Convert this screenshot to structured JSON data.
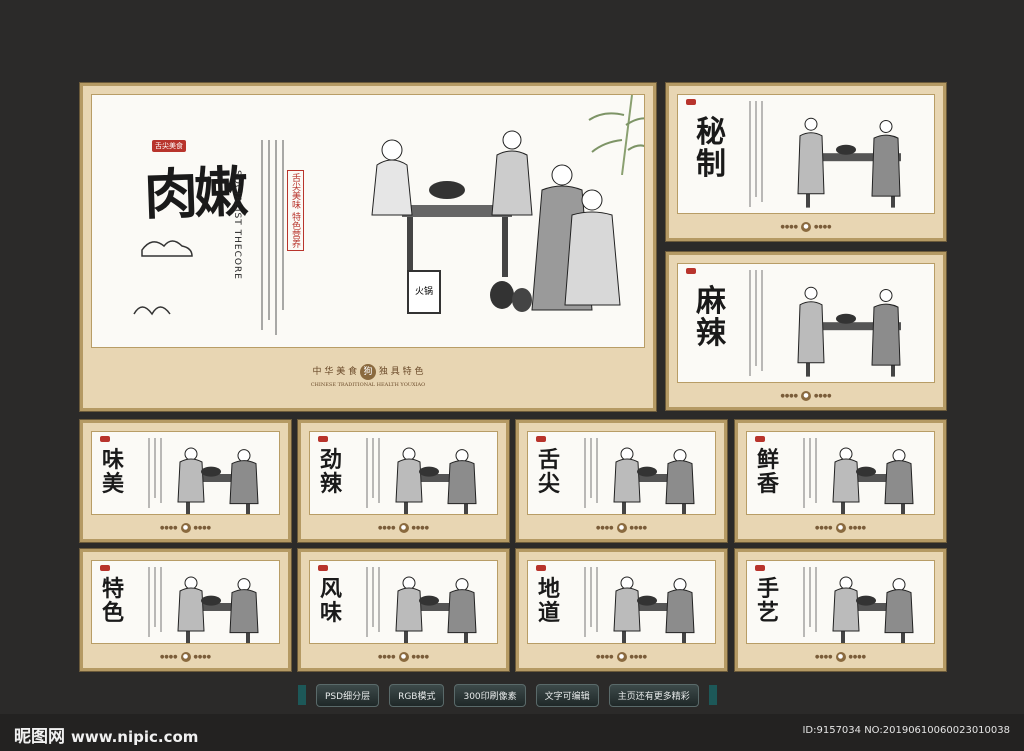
{
  "main_panel": {
    "title": "肉嫩",
    "tag": "舌尖美食",
    "tag2": "舌尖美味 特色营养",
    "vertical": "SOCIALIST THECORE",
    "footer_left": "中 华 美 食",
    "footer_seal": "狗",
    "footer_right": "独 具 特 色",
    "footer_sub": "CHINESE TRADITIONAL HEALTH YOUXIAO",
    "sign": "火锅"
  },
  "panels": [
    {
      "title": "秘制"
    },
    {
      "title": "麻辣"
    },
    {
      "title": "味美"
    },
    {
      "title": "劲辣"
    },
    {
      "title": "舌尖"
    },
    {
      "title": "鲜香"
    },
    {
      "title": "特色"
    },
    {
      "title": "风味"
    },
    {
      "title": "地道"
    },
    {
      "title": "手艺"
    }
  ],
  "toolbar": {
    "buttons": [
      "PSD细分层",
      "RGB模式",
      "300印刷像素",
      "文字可编辑",
      "主页还有更多精彩"
    ]
  },
  "watermark": {
    "logo": "昵图网",
    "url": "www.nipic.com",
    "id": "ID:9157034 NO:20190610060023010038"
  },
  "colors": {
    "background": "#2b2a29",
    "panel_frame": "#e8d6b3",
    "accent_red": "#b8342c",
    "button": "#1f2828"
  }
}
